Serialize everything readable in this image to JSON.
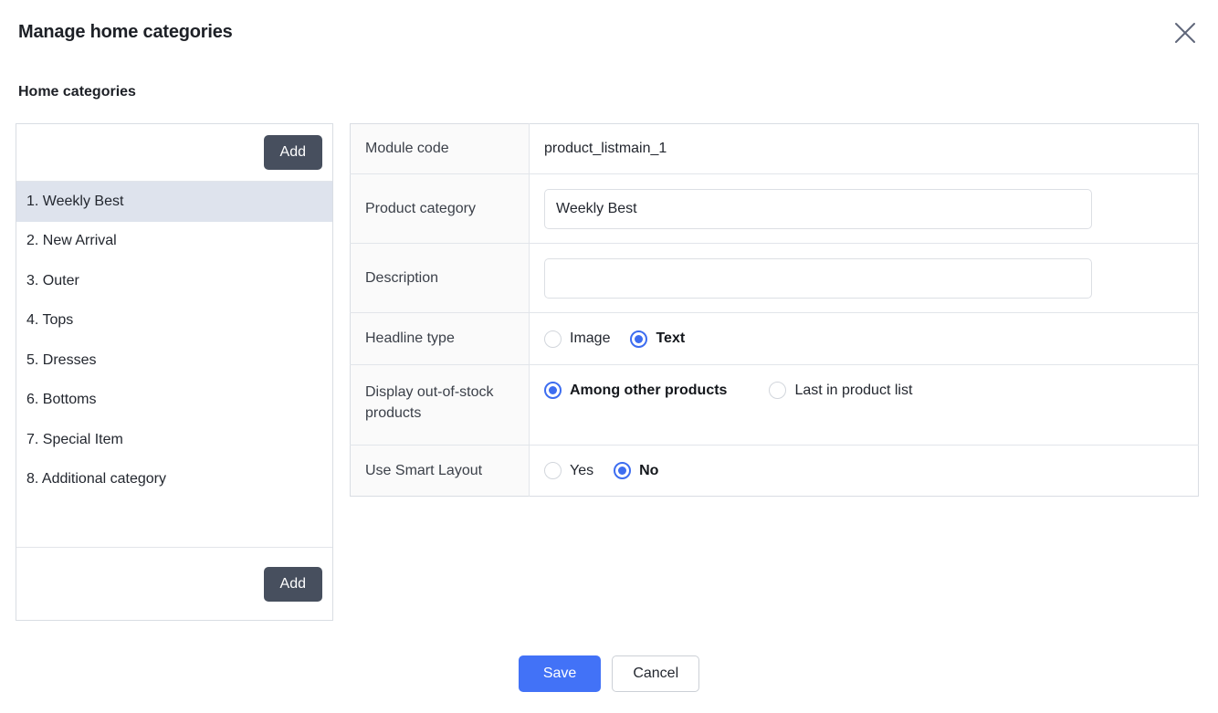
{
  "dialog": {
    "title": "Manage home categories",
    "close_icon": "close-icon",
    "section_title": "Home categories"
  },
  "list_panel": {
    "add_top_label": "Add",
    "add_bottom_label": "Add",
    "items": [
      {
        "label": "1. Weekly Best",
        "selected": true
      },
      {
        "label": "2. New Arrival",
        "selected": false
      },
      {
        "label": "3. Outer",
        "selected": false
      },
      {
        "label": "4. Tops",
        "selected": false
      },
      {
        "label": "5. Dresses",
        "selected": false
      },
      {
        "label": "6. Bottoms",
        "selected": false
      },
      {
        "label": "7. Special Item",
        "selected": false
      },
      {
        "label": "8. Additional category",
        "selected": false
      }
    ]
  },
  "form": {
    "module_code": {
      "label": "Module code",
      "value": "product_listmain_1"
    },
    "product_category": {
      "label": "Product category",
      "value": "Weekly Best",
      "placeholder": ""
    },
    "description": {
      "label": "Description",
      "value": "",
      "placeholder": ""
    },
    "headline_type": {
      "label": "Headline type",
      "options": [
        {
          "label": "Image",
          "checked": false
        },
        {
          "label": "Text",
          "checked": true
        }
      ]
    },
    "display_out_of_stock": {
      "label": "Display out-of-stock products",
      "options": [
        {
          "label": "Among other products",
          "checked": true
        },
        {
          "label": "Last in product list",
          "checked": false
        }
      ]
    },
    "use_smart_layout": {
      "label": "Use Smart Layout",
      "options": [
        {
          "label": "Yes",
          "checked": false
        },
        {
          "label": "No",
          "checked": true
        }
      ]
    }
  },
  "footer": {
    "save_label": "Save",
    "cancel_label": "Cancel"
  },
  "colors": {
    "accent_blue": "#4272f7",
    "radio_blue": "#3d6df0",
    "dark_button": "#474f5e",
    "selected_row": "#dee3ed"
  }
}
